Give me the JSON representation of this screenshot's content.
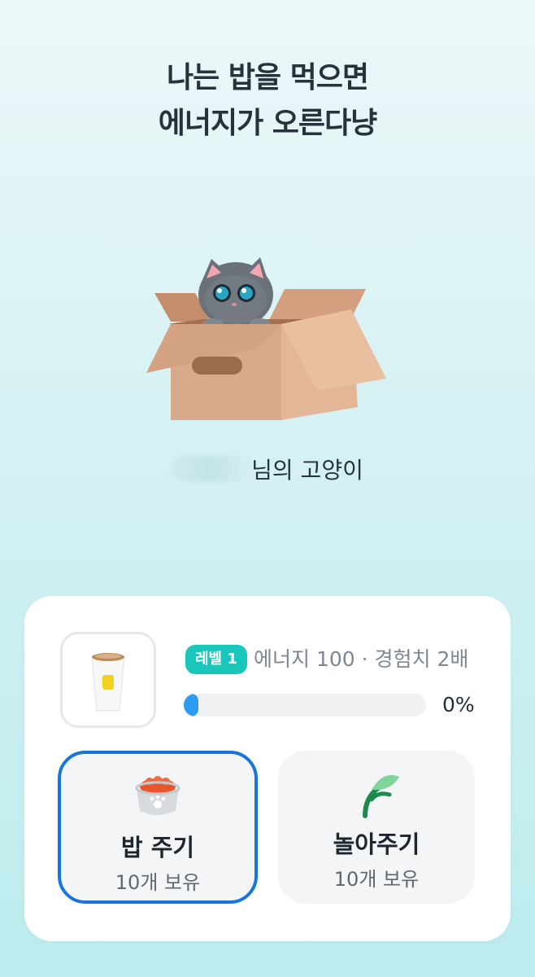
{
  "headline": {
    "line1": "나는 밥을 먹으면",
    "line2": "에너지가 오른다냥"
  },
  "owner": {
    "suffix": "님의 고양이"
  },
  "status": {
    "level_badge": "레벨 1",
    "level_info": "에너지 100 · 경험치 2배",
    "progress_percent_label": "0%",
    "progress_fraction": 0.04
  },
  "actions": {
    "feed": {
      "label": "밥 주기",
      "count": "10개 보유",
      "icon": "food-bowl-icon"
    },
    "play": {
      "label": "놀아주기",
      "count": "10개 보유",
      "icon": "cat-toy-icon"
    }
  },
  "colors": {
    "accent_teal": "#18c7b9",
    "selected_border": "#1676dc",
    "progress": "#2c9bf0"
  }
}
